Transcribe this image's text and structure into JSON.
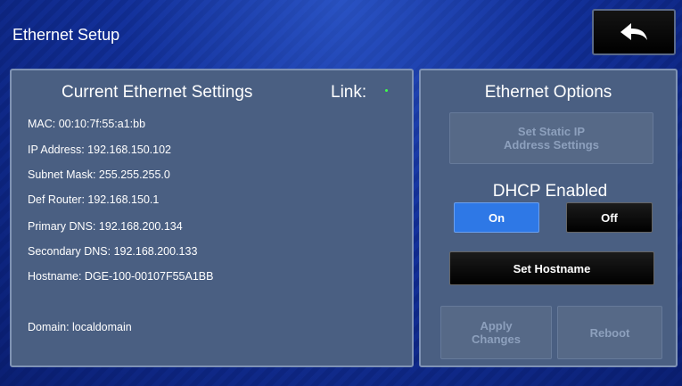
{
  "header": {
    "title": "Ethernet Setup",
    "back_icon": "back-arrow-icon"
  },
  "current_settings": {
    "heading": "Current Ethernet Settings",
    "link_label": "Link:",
    "link_status_color": "#3dff4a",
    "mac": "MAC: 00:10:7f:55:a1:bb",
    "ip_address": "IP Address: 192.168.150.102",
    "subnet_mask": "Subnet Mask: 255.255.255.0",
    "def_router": "Def Router: 192.168.150.1",
    "primary_dns": "Primary DNS: 192.168.200.134",
    "secondary_dns": "Secondary DNS: 192.168.200.133",
    "hostname": "Hostname: DGE-100-00107F55A1BB",
    "domain": "Domain: localdomain"
  },
  "options": {
    "heading": "Ethernet Options",
    "set_static_ip_line1": "Set Static IP",
    "set_static_ip_line2": "Address Settings",
    "dhcp_label": "DHCP Enabled",
    "dhcp_on": "On",
    "dhcp_off": "Off",
    "set_hostname": "Set Hostname",
    "apply_line1": "Apply",
    "apply_line2": "Changes",
    "reboot": "Reboot"
  },
  "colors": {
    "accent_on": "#2e78e6",
    "panel": "#4a5f82"
  }
}
